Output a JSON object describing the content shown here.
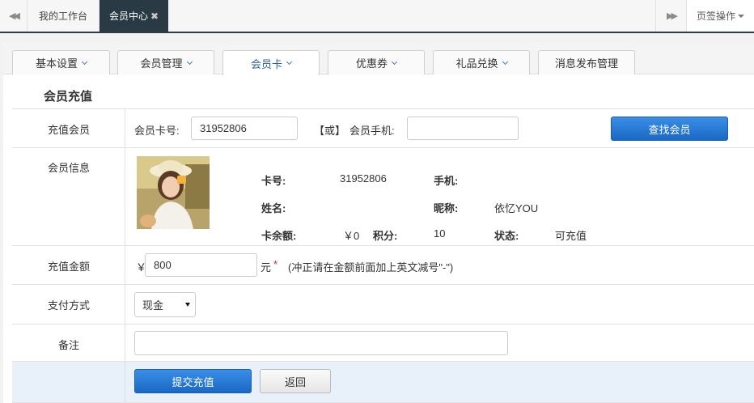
{
  "topbar": {
    "tab_workbench": "我的工作台",
    "tab_active": "会员中心",
    "page_ops": "页签操作"
  },
  "subtabs": [
    {
      "label": "基本设置"
    },
    {
      "label": "会员管理"
    },
    {
      "label": "会员卡"
    },
    {
      "label": "优惠券"
    },
    {
      "label": "礼品兑换"
    },
    {
      "label": "消息发布管理"
    }
  ],
  "section_title": "会员充值",
  "recharge_member": {
    "label": "充值会员",
    "card_label": "会员卡号:",
    "card_value": "31952806",
    "or_text": "【或】",
    "phone_label": "会员手机:",
    "phone_value": "",
    "find_button": "查找会员"
  },
  "member_info": {
    "label": "会员信息",
    "card_no_label": "卡号:",
    "card_no": "31952806",
    "phone_label": "手机:",
    "phone": "",
    "name_label": "姓名:",
    "name": "",
    "nickname_label": "昵称:",
    "nickname": "依忆YOU",
    "balance_label": "卡余额:",
    "balance": "￥0",
    "points_label": "积分:",
    "points": "10",
    "status_label": "状态:",
    "status": "可充值"
  },
  "amount": {
    "label": "充值金额",
    "currency": "￥",
    "value": "800",
    "unit": "元",
    "required": "*",
    "hint": "(冲正请在金额前面加上英文减号\"-\")"
  },
  "payment": {
    "label": "支付方式",
    "selected": "现金"
  },
  "remark": {
    "label": "备注",
    "value": ""
  },
  "actions": {
    "submit": "提交充值",
    "back": "返回"
  },
  "colors": {
    "topbar_active": "#2a3a44",
    "primary_button": "#1a68c5",
    "action_row_bg": "#e8f0fa"
  }
}
